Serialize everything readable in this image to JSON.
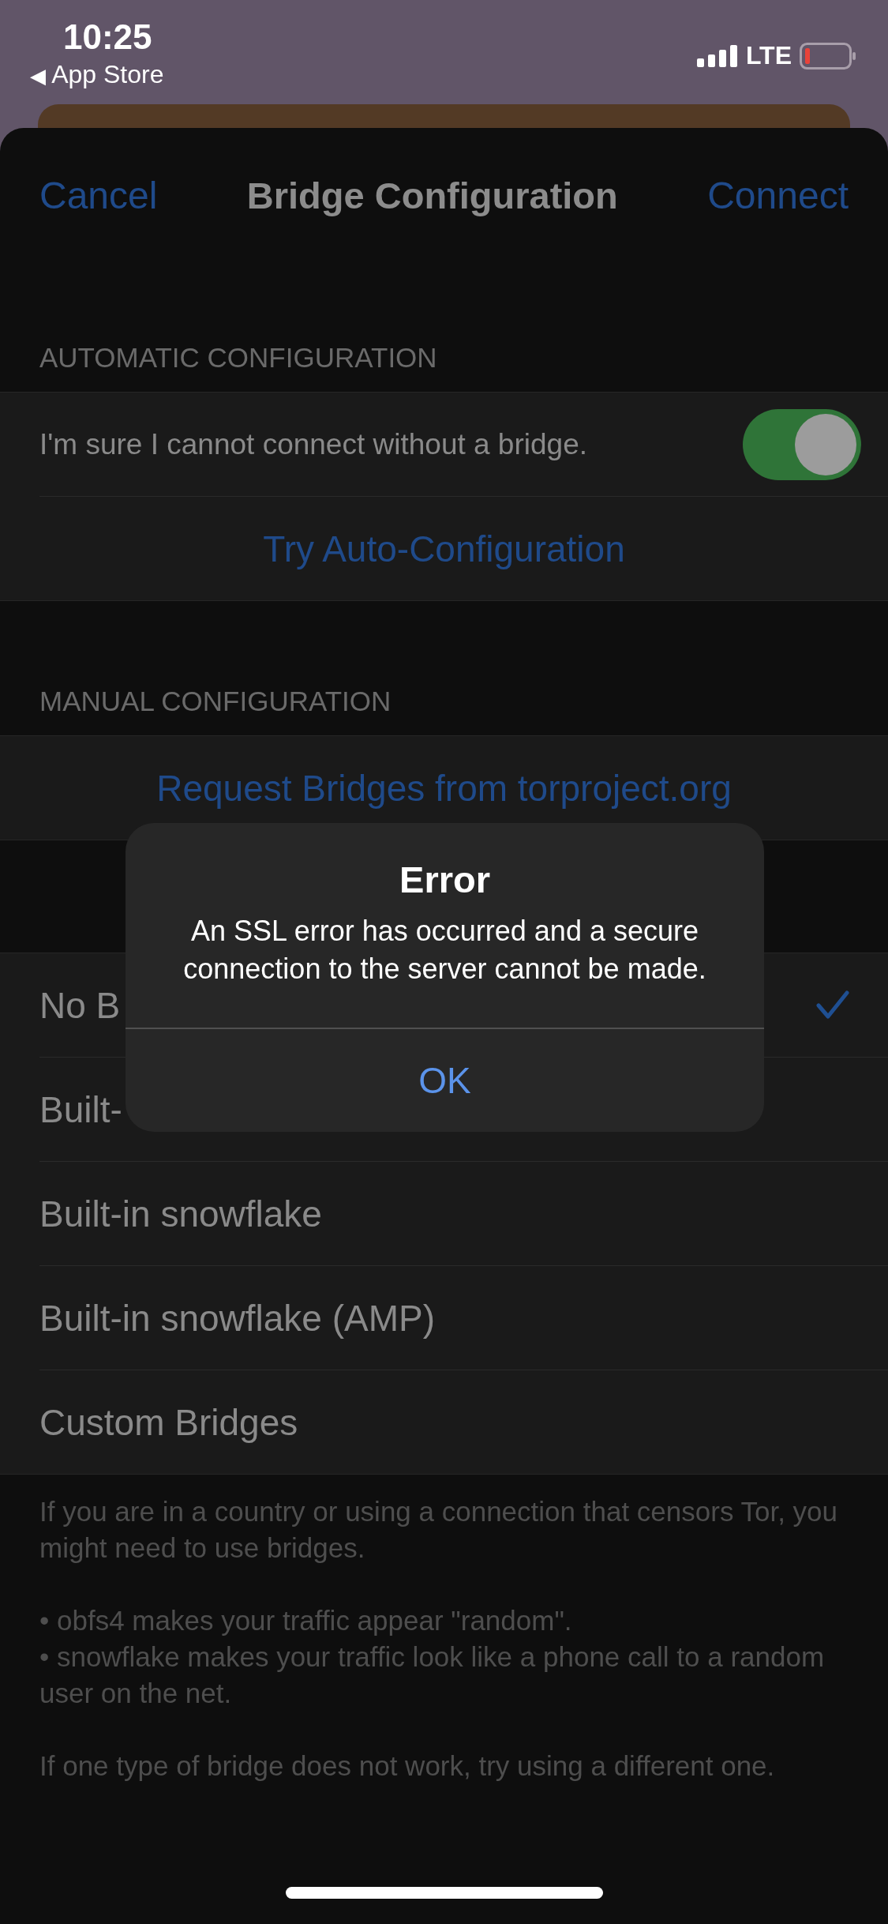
{
  "status_bar": {
    "time": "10:25",
    "back_glyph": "◀",
    "back_app": "App Store",
    "network": "LTE"
  },
  "nav": {
    "cancel": "Cancel",
    "title": "Bridge Configuration",
    "connect": "Connect"
  },
  "automatic": {
    "header": "AUTOMATIC CONFIGURATION",
    "toggle_label": "I'm sure I cannot connect without a bridge.",
    "toggle_on": true,
    "action": "Try Auto-Configuration"
  },
  "manual": {
    "header": "MANUAL CONFIGURATION",
    "action": "Request Bridges from torproject.org"
  },
  "bridge_options": [
    {
      "label": "No B",
      "selected": true
    },
    {
      "label": "Built-",
      "selected": false
    },
    {
      "label": "Built-in snowflake",
      "selected": false
    },
    {
      "label": "Built-in snowflake (AMP)",
      "selected": false
    },
    {
      "label": "Custom Bridges",
      "selected": false
    }
  ],
  "footer": [
    {
      "kind": "paragraph",
      "text": "If you are in a country or using a connection that censors Tor, you might need to use bridges."
    },
    {
      "kind": "bullet",
      "text": "• obfs4 makes your traffic appear \"random\"."
    },
    {
      "kind": "bullet",
      "text": "• snowflake makes your traffic look like a phone call to a random user on the net."
    },
    {
      "kind": "paragraph",
      "text": "If one type of bridge does not work, try using a different one."
    }
  ],
  "alert": {
    "title": "Error",
    "message": "An SSL error has occurred and a secure connection to the server cannot be made.",
    "button": "OK"
  }
}
